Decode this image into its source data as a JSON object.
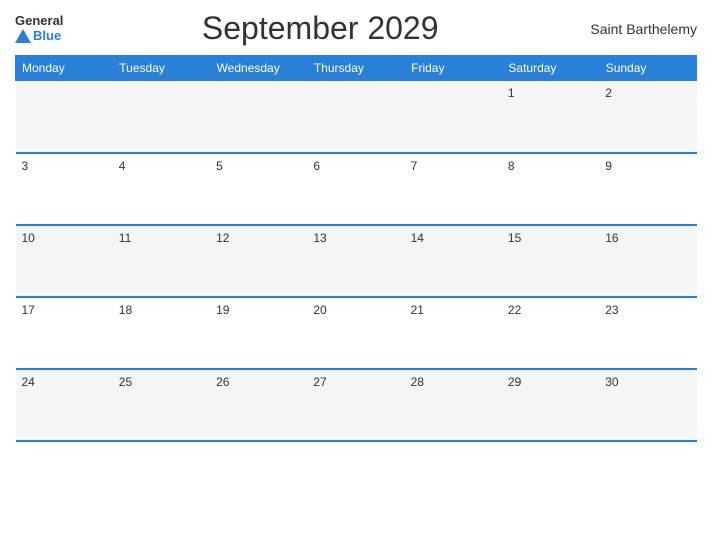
{
  "header": {
    "logo_general": "General",
    "logo_blue": "Blue",
    "title": "September 2029",
    "region": "Saint Barthelemy"
  },
  "weekdays": [
    "Monday",
    "Tuesday",
    "Wednesday",
    "Thursday",
    "Friday",
    "Saturday",
    "Sunday"
  ],
  "weeks": [
    [
      {
        "day": "",
        "empty": true
      },
      {
        "day": "",
        "empty": true
      },
      {
        "day": "",
        "empty": true
      },
      {
        "day": "",
        "empty": true
      },
      {
        "day": "",
        "empty": true
      },
      {
        "day": "1",
        "empty": false
      },
      {
        "day": "2",
        "empty": false
      }
    ],
    [
      {
        "day": "3",
        "empty": false
      },
      {
        "day": "4",
        "empty": false
      },
      {
        "day": "5",
        "empty": false
      },
      {
        "day": "6",
        "empty": false
      },
      {
        "day": "7",
        "empty": false
      },
      {
        "day": "8",
        "empty": false
      },
      {
        "day": "9",
        "empty": false
      }
    ],
    [
      {
        "day": "10",
        "empty": false
      },
      {
        "day": "11",
        "empty": false
      },
      {
        "day": "12",
        "empty": false
      },
      {
        "day": "13",
        "empty": false
      },
      {
        "day": "14",
        "empty": false
      },
      {
        "day": "15",
        "empty": false
      },
      {
        "day": "16",
        "empty": false
      }
    ],
    [
      {
        "day": "17",
        "empty": false
      },
      {
        "day": "18",
        "empty": false
      },
      {
        "day": "19",
        "empty": false
      },
      {
        "day": "20",
        "empty": false
      },
      {
        "day": "21",
        "empty": false
      },
      {
        "day": "22",
        "empty": false
      },
      {
        "day": "23",
        "empty": false
      }
    ],
    [
      {
        "day": "24",
        "empty": false
      },
      {
        "day": "25",
        "empty": false
      },
      {
        "day": "26",
        "empty": false
      },
      {
        "day": "27",
        "empty": false
      },
      {
        "day": "28",
        "empty": false
      },
      {
        "day": "29",
        "empty": false
      },
      {
        "day": "30",
        "empty": false
      }
    ]
  ]
}
